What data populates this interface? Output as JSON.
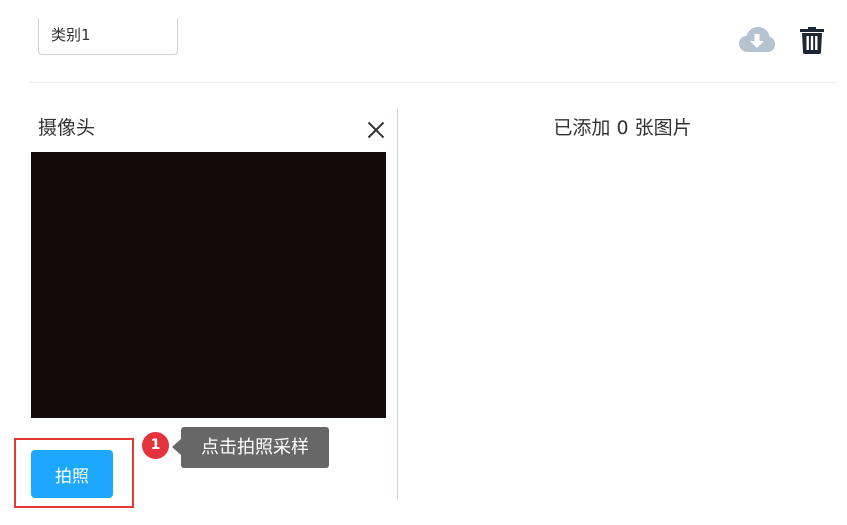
{
  "toolbar": {
    "class_name_value": "类别1",
    "download_icon": "cloud-download-icon",
    "delete_icon": "trash-icon"
  },
  "webcam_panel": {
    "title": "摄像头",
    "close_icon": "close-icon",
    "capture_button_label": "拍照"
  },
  "images_panel": {
    "count_text": "已添加 0 张图片"
  },
  "guide": {
    "step_number": "1",
    "tooltip_text": "点击拍照采样"
  },
  "colors": {
    "primary_button": "#1ea7ff",
    "highlight_border": "#e53935",
    "badge": "#e5333d",
    "tooltip_bg": "#676767",
    "video_bg": "#140a0c",
    "download_icon": "#b5c2cf",
    "delete_icon": "#1c2733"
  }
}
